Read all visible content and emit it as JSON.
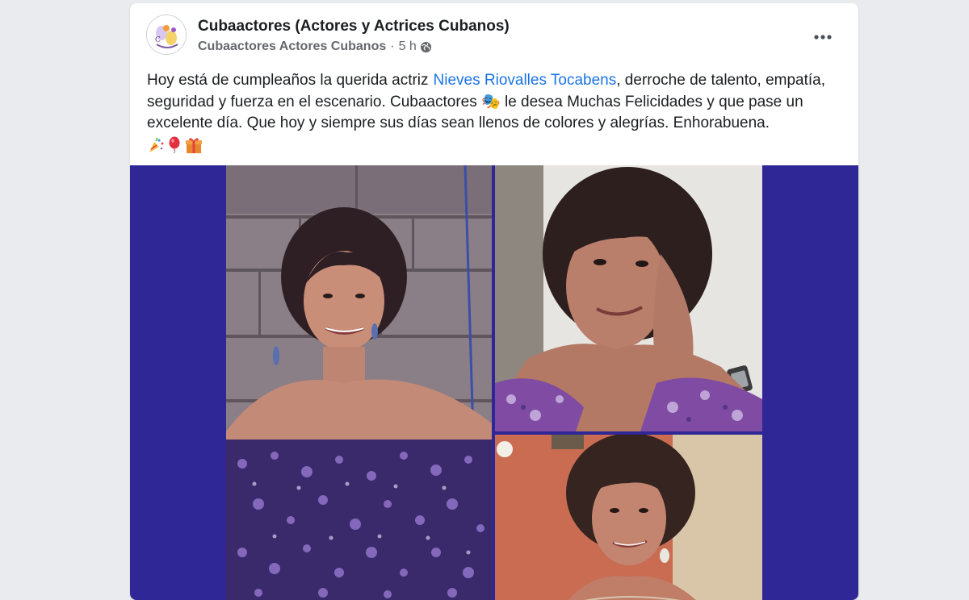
{
  "post": {
    "page_name": "Cubaactores (Actores y Actrices Cubanos)",
    "sub_name": "Cubaactores Actores Cubanos",
    "separator": "·",
    "time": "5 h",
    "privacy_icon": "globe-icon",
    "more_icon": "more-horizontal-icon",
    "text_intro": "Hoy está de cumpleaños la querida actriz",
    "mention": "Nieves Riovalles Tocabens",
    "text_body": ", derroche de talento, empatía, seguridad y fuerza en el escenario. Cubaactores",
    "theater_emoji": "🎭",
    "text_after_emoji": " le desea Muchas Felicidades y que pase un excelente día. Que hoy y siempre sus días sean llenos de colores y alegrías. Enhorabuena.",
    "trailing_emojis": [
      "party-popper-icon",
      "balloon-icon",
      "gift-icon"
    ]
  },
  "colors": {
    "mention": "#1b74e4",
    "media_background": "#2e2795",
    "meta_text": "#65676b",
    "main_text": "#1c1e21"
  },
  "media": {
    "photos": [
      "photo-left",
      "photo-top-right",
      "photo-bottom-right"
    ]
  }
}
